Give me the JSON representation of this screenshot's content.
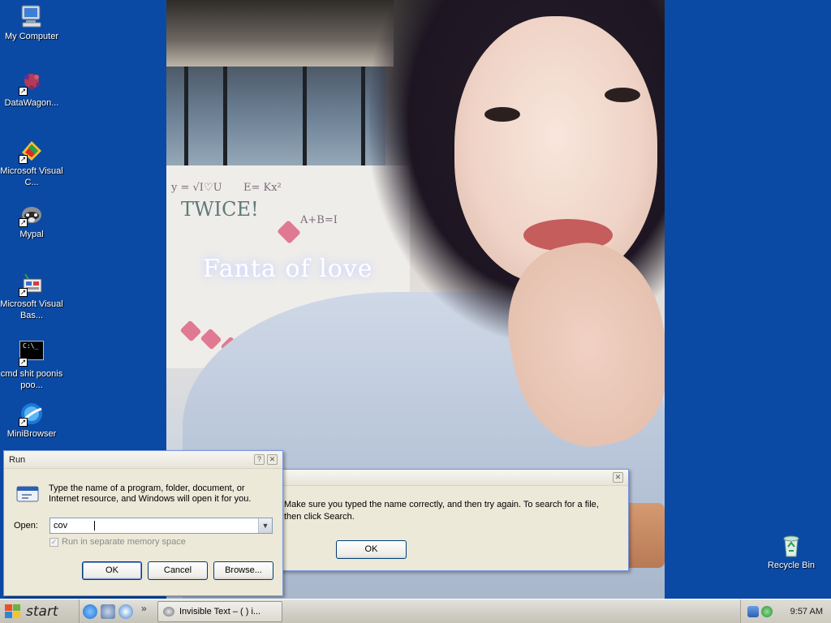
{
  "desktop": {
    "icons": [
      {
        "label": "My Computer",
        "icon": "my-computer-icon"
      },
      {
        "label": "DataWagon...",
        "icon": "datawagon-icon"
      },
      {
        "label": "Microsoft Visual C...",
        "icon": "visual-c-icon"
      },
      {
        "label": "Mypal",
        "icon": "mypal-icon"
      },
      {
        "label": "Microsoft Visual Bas...",
        "icon": "visual-basic-icon"
      },
      {
        "label": "cmd shit poonis poo...",
        "icon": "cmd-icon"
      },
      {
        "label": "MiniBrowser",
        "icon": "minibrowser-icon"
      },
      {
        "label": "Recycle Bin",
        "icon": "recycle-bin-icon"
      }
    ],
    "wallpaper_text": "TWICE!",
    "cmd_glyph": "C:\\_"
  },
  "run_dialog": {
    "title": "Run",
    "description": "Type the name of a program, folder, document, or Internet resource, and Windows will open it for you.",
    "open_label": "Open:",
    "open_value": "cov",
    "checkbox_label": "Run in separate memory space",
    "checkbox_checked": true,
    "ok": "OK",
    "cancel": "Cancel",
    "browse": "Browse..."
  },
  "error_dialog": {
    "message_line1": "Make sure you typed the name correctly, and then try again. To search for a file,",
    "message_line2": "then click Search.",
    "ok": "OK"
  },
  "taskbar": {
    "start_label": "start",
    "task_label": "Invisible Text – (  ) i...",
    "overflow": "»",
    "clock": "9:57 AM"
  },
  "colors": {
    "desktop": "#0b4aa4",
    "taskbar": "#d3d1c8",
    "window_face": "#ece9d8",
    "button_border": "#003c74"
  }
}
